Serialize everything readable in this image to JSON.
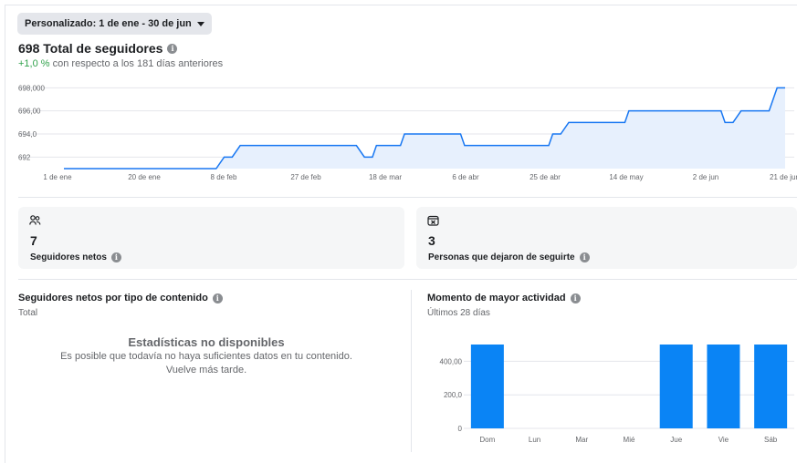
{
  "header": {
    "date_range_label": "Personalizado: 1 de ene - 30 de jun"
  },
  "followers": {
    "title": "698 Total de seguidores",
    "change_pct": "+1,0 %",
    "change_text": "con respecto a los 181 días anteriores"
  },
  "chart_data": [
    {
      "type": "area",
      "title": "",
      "xlabel": "",
      "ylabel": "",
      "x_ticks": [
        "1 de ene",
        "20 de ene",
        "8 de feb",
        "27 de feb",
        "18 de mar",
        "6 de abr",
        "25 de abr",
        "14 de may",
        "2 de jun",
        "21 de jun"
      ],
      "y_ticks": [
        "692",
        "694,0",
        "696,00",
        "698,000"
      ],
      "ylim": [
        691,
        698.5
      ],
      "grid": true,
      "x": [
        "1 de ene",
        "8 de feb",
        "10 de feb",
        "12 de feb",
        "14 de feb",
        "15 de mar",
        "17 de mar",
        "19 de mar",
        "20 de mar",
        "26 de mar",
        "27 de mar",
        "10 de abr",
        "11 de abr",
        "2 de may",
        "3 de may",
        "5 de may",
        "7 de may",
        "21 de may",
        "22 de may",
        "14 de jun",
        "15 de jun",
        "17 de jun",
        "19 de jun",
        "26 de jun",
        "28 de jun",
        "30 de jun"
      ],
      "values": [
        691,
        691,
        692,
        692,
        693,
        693,
        692,
        692,
        693,
        693,
        694,
        694,
        693,
        693,
        694,
        694,
        695,
        695,
        696,
        696,
        695,
        695,
        696,
        696,
        698,
        698
      ],
      "color": "#1877f2",
      "fill": "#e7f0fd"
    },
    {
      "type": "bar",
      "title": "Momento de mayor actividad",
      "categories": [
        "Dom",
        "Lun",
        "Mar",
        "Mié",
        "Jue",
        "Vie",
        "Sáb"
      ],
      "values": [
        500,
        0,
        0,
        0,
        500,
        500,
        500
      ],
      "y_ticks": [
        "0",
        "200,0",
        "400,00"
      ],
      "ylim": [
        0,
        500
      ],
      "grid": true,
      "color": "#0a84f5"
    }
  ],
  "cards": {
    "net_followers": {
      "icon": "people-icon",
      "value": "7",
      "label": "Seguidores netos"
    },
    "unfollows": {
      "icon": "unfollow-icon",
      "value": "3",
      "label": "Personas que dejaron de seguirte"
    }
  },
  "content_type": {
    "title": "Seguidores netos por tipo de contenido",
    "subtitle": "Total",
    "empty_title": "Estadísticas no disponibles",
    "empty_line1": "Es posible que todavía no haya suficientes datos en tu contenido.",
    "empty_line2": "Vuelve más tarde."
  },
  "activity": {
    "title": "Momento de mayor actividad",
    "subtitle": "Últimos 28 días"
  },
  "colors": {
    "accent": "#1877f2",
    "positive": "#31a24c",
    "bar": "#0a84f5"
  }
}
